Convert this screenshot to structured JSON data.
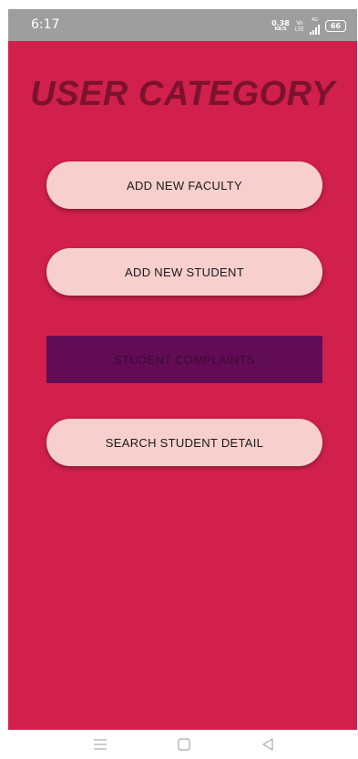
{
  "status_bar": {
    "time": "6:17",
    "speed_value": "0.38",
    "speed_unit": "KB/S",
    "volte_top": "Vo",
    "volte_bottom": "LTE",
    "network": "4G",
    "battery": "66"
  },
  "page": {
    "title": "USER CATEGORY"
  },
  "buttons": {
    "add_faculty": "ADD NEW FACULTY",
    "add_student": "ADD NEW STUDENT",
    "complaints": "STUDENT COMPLAINTS",
    "search_student": "SEARCH STUDENT DETAIL"
  },
  "nav_bar": {
    "menu_icon": "menu-lines-icon",
    "home_icon": "square-home-icon",
    "back_icon": "triangle-back-icon"
  },
  "colors": {
    "background": "#d0204b",
    "title": "#7c1230",
    "pill_button": "#f7cfcc",
    "complaints_button": "#620c55",
    "status_bar": "#9e9e9e"
  }
}
